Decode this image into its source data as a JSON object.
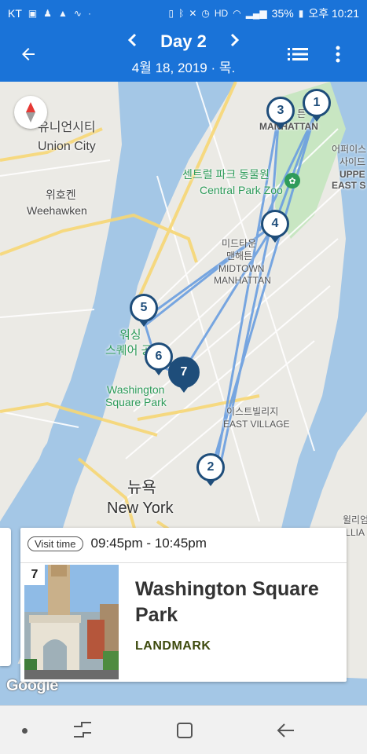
{
  "status_bar": {
    "carrier": "KT",
    "battery": "35%",
    "time": "오후 10:21"
  },
  "header": {
    "title": "Day 2",
    "date": "4월 18, 2019 · 목.",
    "prev_icon": "chevron-left-icon",
    "next_icon": "chevron-right-icon",
    "back_icon": "arrow-back-icon",
    "list_icon": "list-icon",
    "more_icon": "more-vert-icon"
  },
  "map": {
    "labels": {
      "union_city_ko": "유니언시티",
      "union_city": "Union City",
      "weehawken_ko": "위호켄",
      "weehawken": "Weehawken",
      "manhattan": "MANHATTAN",
      "manhattan_ko_partial": "튼",
      "zoo_ko": "센트럴 파크 동물원",
      "zoo": "Central Park Zoo",
      "upper_east_ko": "어퍼이스",
      "upper_east_ko2": "사이드",
      "upper_east": "UPPE",
      "upper_east2": "EAST S",
      "midtown_ko": "미드타운",
      "midtown_ko2": "맨해튼",
      "midtown": "MIDTOWN",
      "midtown2": "MANHATTAN",
      "wsp_ko": "워싱",
      "wsp_ko2": "스퀘어 공",
      "wsp": "Washington",
      "wsp2": "Square Park",
      "east_village_ko": "이스트빌리지",
      "east_village": "EAST VILLAGE",
      "ny_ko": "뉴욕",
      "ny": "New York",
      "williamsburg_ko": "윌리엄",
      "williamsburg": "ILLIA",
      "google": "Google"
    },
    "pins": [
      "1",
      "2",
      "3",
      "4",
      "5",
      "6",
      "7"
    ],
    "active_pin": "7",
    "route_color": "#6a9ee0"
  },
  "card": {
    "visit_label": "Visit time",
    "visit_time": "09:45pm - 10:45pm",
    "number": "7",
    "name": "Washington Square Park",
    "category": "LANDMARK"
  },
  "colors": {
    "primary": "#1a73d8",
    "pin": "#1e4d7a",
    "water": "#a4c7e6",
    "park": "#c8e6c2"
  }
}
